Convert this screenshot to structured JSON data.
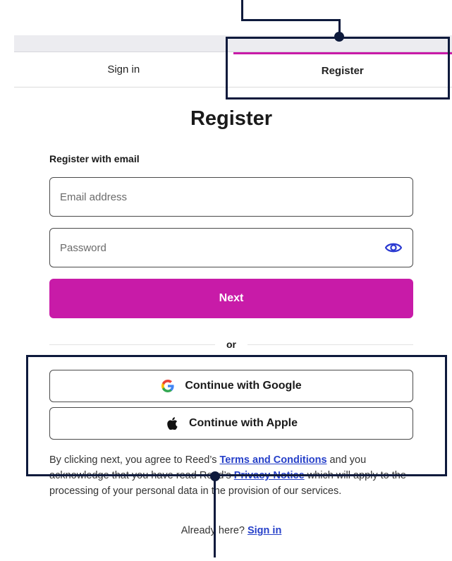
{
  "tabs": {
    "signin_label": "Sign in",
    "register_label": "Register"
  },
  "form": {
    "title": "Register",
    "section_label": "Register with email",
    "email_placeholder": "Email address",
    "password_placeholder": "Password",
    "next_label": "Next",
    "divider_label": "or",
    "google_label": "Continue with Google",
    "apple_label": "Continue with Apple"
  },
  "legal": {
    "part1": "By clicking next, you agree to Reed’s ",
    "terms_link": "Terms and Conditions",
    "part2": " and you acknowledge that you have read Reed’s ",
    "privacy_link": "Privacy Notice",
    "part3": " which will apply to the processing of your personal data in the provision of our services."
  },
  "footer": {
    "already_text": "Already here?",
    "signin_link": "Sign in"
  },
  "icons": {
    "password_toggle": "eye-icon",
    "google": "google-icon",
    "apple": "apple-icon"
  },
  "colors": {
    "accent": "#c81ba8",
    "link": "#2640c9",
    "annotation": "#0e1a3c"
  }
}
